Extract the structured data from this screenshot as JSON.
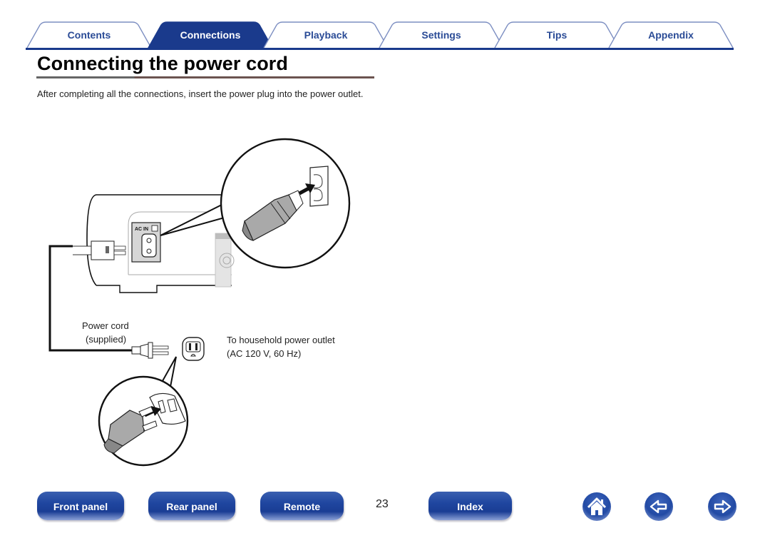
{
  "tabs": [
    {
      "label": "Contents",
      "active": false
    },
    {
      "label": "Connections",
      "active": true
    },
    {
      "label": "Playback",
      "active": false
    },
    {
      "label": "Settings",
      "active": false
    },
    {
      "label": "Tips",
      "active": false
    },
    {
      "label": "Appendix",
      "active": false
    }
  ],
  "page": {
    "title": "Connecting the power cord",
    "intro": "After completing all the connections, insert the power plug into the power outlet."
  },
  "illustration": {
    "ac_in_label": "AC IN",
    "power_cord_label_line1": "Power cord",
    "power_cord_label_line2": "(supplied)",
    "outlet_label_line1": "To household power outlet",
    "outlet_label_line2": "(AC 120 V, 60 Hz)"
  },
  "footer": {
    "front_panel": "Front panel",
    "rear_panel": "Rear panel",
    "remote": "Remote",
    "page_number": "23",
    "index": "Index",
    "home_icon": "home-icon",
    "back_icon": "arrow-left-icon",
    "forward_icon": "arrow-right-icon"
  },
  "colors": {
    "accent": "#1a3a8c",
    "tab_text": "#2a4b96"
  }
}
